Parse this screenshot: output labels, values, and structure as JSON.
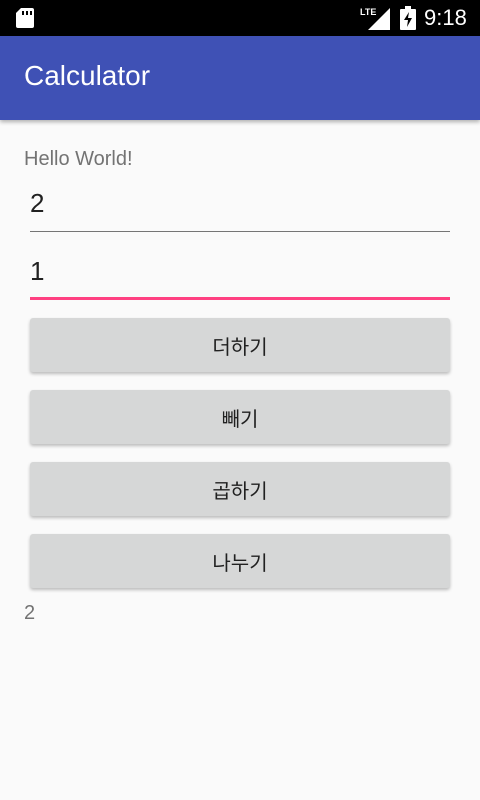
{
  "status_bar": {
    "time": "9:18",
    "network_label": "LTE",
    "icons": [
      "sd-card-icon",
      "lte-signal-icon",
      "battery-charging-icon"
    ]
  },
  "app_bar": {
    "title": "Calculator",
    "color": "#3f51b5"
  },
  "content": {
    "hello_text": "Hello World!",
    "input1_value": "2",
    "input2_value": "1",
    "buttons": {
      "add": "더하기",
      "subtract": "빼기",
      "multiply": "곱하기",
      "divide": "나누기"
    },
    "result": "2"
  },
  "colors": {
    "accent": "#ff4081",
    "button_bg": "#d6d7d7",
    "background": "#fafafa"
  }
}
